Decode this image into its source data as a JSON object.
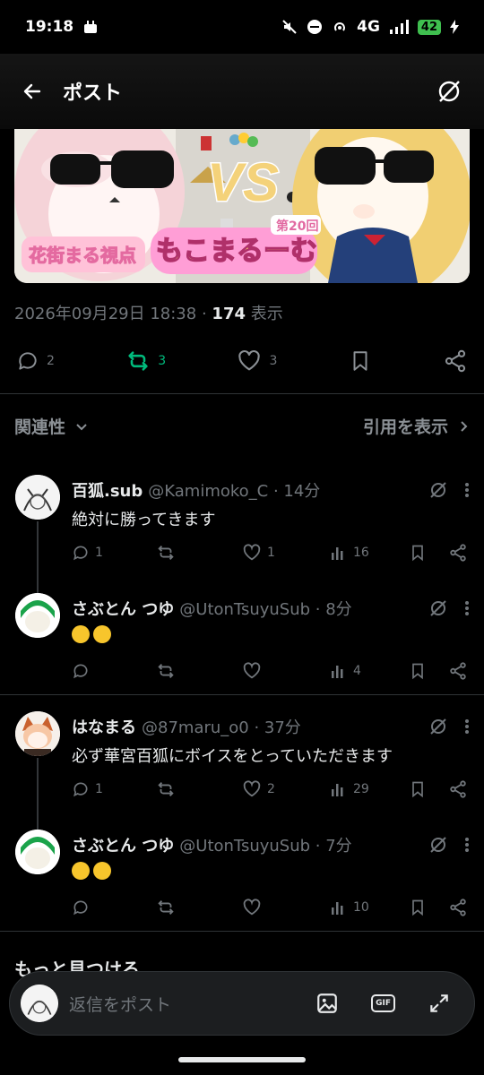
{
  "status": {
    "time": "19:18",
    "network": "4G",
    "battery": "42"
  },
  "header": {
    "title": "ポスト"
  },
  "banner": {
    "vs": "VS",
    "room": "もこまるーむ",
    "episode": "第20回",
    "view": "花街まる視点"
  },
  "post": {
    "date": "2026年09月29日 18:38",
    "sep": "·",
    "views_count": "174",
    "views_label": "表示",
    "replies": "2",
    "reposts": "3",
    "likes": "3"
  },
  "sort": {
    "label": "関連性",
    "quotes": "引用を表示"
  },
  "replies": [
    {
      "name": "百狐.sub",
      "meta": "@Kamimoko_C · 14分",
      "text": "絶対に勝ってきます",
      "replies": "1",
      "reposts": "",
      "likes": "1",
      "views": "16"
    },
    {
      "name": "さぶとん つゆ",
      "meta": "@UtonTsuyuSub · 8分",
      "text": "",
      "replies": "",
      "reposts": "",
      "likes": "",
      "views": "4"
    },
    {
      "name": "はなまる",
      "meta": "@87maru_o0 · 37分",
      "text": "必ず華宮百狐にボイスをとっていただきます",
      "replies": "1",
      "reposts": "",
      "likes": "2",
      "views": "29"
    },
    {
      "name": "さぶとん つゆ",
      "meta": "@UtonTsuyuSub · 7分",
      "text": "",
      "replies": "",
      "reposts": "",
      "likes": "",
      "views": "10"
    }
  ],
  "more": {
    "title": "もっと見つける"
  },
  "composer": {
    "placeholder": "返信をポスト",
    "gif": "GIF"
  },
  "colors": {
    "repost_active": "#00ba7c",
    "accent": "#ffa6e0"
  }
}
